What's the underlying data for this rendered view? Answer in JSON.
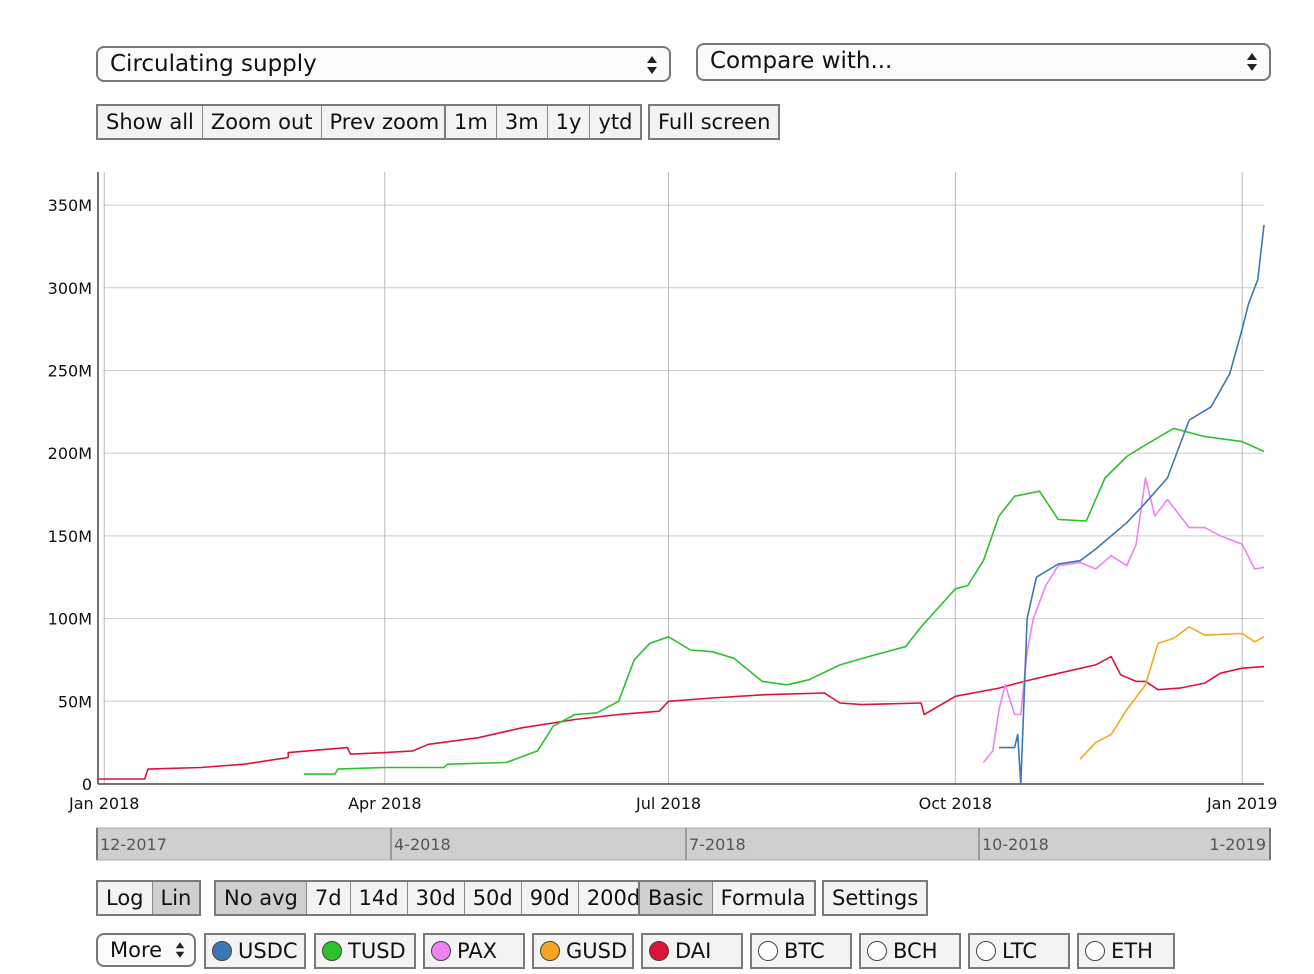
{
  "controls": {
    "metric_select": "Circulating supply",
    "compare_select": "Compare with...",
    "zoom_buttons": [
      "Show all",
      "Zoom out",
      "Prev zoom"
    ],
    "range_buttons": [
      "1m",
      "3m",
      "1y",
      "ytd"
    ],
    "fullscreen_label": "Full screen",
    "scale_buttons": [
      "Log",
      "Lin"
    ],
    "scale_active": "Lin",
    "avg_buttons": [
      "No avg",
      "7d",
      "14d",
      "30d",
      "50d",
      "90d",
      "200d"
    ],
    "avg_active": "No avg",
    "mode_buttons": [
      "Basic",
      "Formula"
    ],
    "mode_active": "Basic",
    "settings_label": "Settings",
    "more_label": "More"
  },
  "legend": [
    {
      "label": "USDC",
      "color": "#3c78b4",
      "active": true
    },
    {
      "label": "TUSD",
      "color": "#2fc02f",
      "active": true
    },
    {
      "label": "PAX",
      "color": "#ee82ee",
      "active": true
    },
    {
      "label": "GUSD",
      "color": "#f5a623",
      "active": true
    },
    {
      "label": "DAI",
      "color": "#dc143c",
      "active": true
    },
    {
      "label": "BTC",
      "color": "#ffffff",
      "active": false
    },
    {
      "label": "BCH",
      "color": "#ffffff",
      "active": false
    },
    {
      "label": "LTC",
      "color": "#ffffff",
      "active": false
    },
    {
      "label": "ETH",
      "color": "#ffffff",
      "active": false
    }
  ],
  "navigator": {
    "labels": [
      "12-2017",
      "4-2018",
      "7-2018",
      "10-2018",
      "1-2019"
    ]
  },
  "chart_data": {
    "type": "line",
    "title": "",
    "xlabel": "",
    "ylabel": "",
    "x_ticks": [
      "Jan 2018",
      "Apr 2018",
      "Jul 2018",
      "Oct 2018",
      "Jan 2019"
    ],
    "x_tick_dates": [
      "2018-01-01",
      "2018-04-01",
      "2018-07-01",
      "2018-10-01",
      "2019-01-01"
    ],
    "y_ticks": [
      "0",
      "50M",
      "100M",
      "150M",
      "200M",
      "250M",
      "300M",
      "350M"
    ],
    "y_tick_values": [
      0,
      50,
      100,
      150,
      200,
      250,
      300,
      350
    ],
    "y_unit": "M",
    "xlim": [
      "2017-12-30",
      "2019-01-08"
    ],
    "ylim": [
      0,
      370
    ],
    "grid": true,
    "series": [
      {
        "name": "DAI",
        "color": "#dc143c",
        "points": [
          [
            "2017-12-30",
            3
          ],
          [
            "2018-01-14",
            3
          ],
          [
            "2018-01-15",
            9
          ],
          [
            "2018-02-01",
            10
          ],
          [
            "2018-02-15",
            12
          ],
          [
            "2018-03-01",
            16
          ],
          [
            "2018-03-01",
            19
          ],
          [
            "2018-03-20",
            22
          ],
          [
            "2018-03-21",
            18
          ],
          [
            "2018-04-01",
            19
          ],
          [
            "2018-04-10",
            20
          ],
          [
            "2018-04-15",
            24
          ],
          [
            "2018-05-01",
            28
          ],
          [
            "2018-05-15",
            34
          ],
          [
            "2018-06-01",
            39
          ],
          [
            "2018-06-15",
            42
          ],
          [
            "2018-06-28",
            44
          ],
          [
            "2018-07-01",
            50
          ],
          [
            "2018-07-15",
            52
          ],
          [
            "2018-08-01",
            54
          ],
          [
            "2018-08-20",
            55
          ],
          [
            "2018-08-25",
            49
          ],
          [
            "2018-09-01",
            48
          ],
          [
            "2018-09-20",
            49
          ],
          [
            "2018-09-21",
            42
          ],
          [
            "2018-10-01",
            53
          ],
          [
            "2018-10-15",
            58
          ],
          [
            "2018-10-23",
            62
          ],
          [
            "2018-11-01",
            66
          ],
          [
            "2018-11-15",
            72
          ],
          [
            "2018-11-20",
            77
          ],
          [
            "2018-11-23",
            66
          ],
          [
            "2018-11-28",
            62
          ],
          [
            "2018-12-01",
            62
          ],
          [
            "2018-12-05",
            57
          ],
          [
            "2018-12-12",
            58
          ],
          [
            "2018-12-20",
            61
          ],
          [
            "2018-12-25",
            67
          ],
          [
            "2019-01-01",
            70
          ],
          [
            "2019-01-08",
            71
          ]
        ]
      },
      {
        "name": "TUSD",
        "color": "#2fc02f",
        "points": [
          [
            "2018-03-06",
            6
          ],
          [
            "2018-03-16",
            6
          ],
          [
            "2018-03-17",
            9
          ],
          [
            "2018-04-01",
            10
          ],
          [
            "2018-04-20",
            10
          ],
          [
            "2018-04-21",
            12
          ],
          [
            "2018-05-10",
            13
          ],
          [
            "2018-05-20",
            20
          ],
          [
            "2018-05-25",
            35
          ],
          [
            "2018-06-01",
            42
          ],
          [
            "2018-06-08",
            43
          ],
          [
            "2018-06-15",
            50
          ],
          [
            "2018-06-20",
            75
          ],
          [
            "2018-06-25",
            85
          ],
          [
            "2018-07-01",
            89
          ],
          [
            "2018-07-08",
            81
          ],
          [
            "2018-07-15",
            80
          ],
          [
            "2018-07-22",
            76
          ],
          [
            "2018-07-31",
            62
          ],
          [
            "2018-08-08",
            60
          ],
          [
            "2018-08-15",
            63
          ],
          [
            "2018-08-25",
            72
          ],
          [
            "2018-09-05",
            78
          ],
          [
            "2018-09-15",
            83
          ],
          [
            "2018-09-20",
            95
          ],
          [
            "2018-10-01",
            118
          ],
          [
            "2018-10-05",
            120
          ],
          [
            "2018-10-10",
            135
          ],
          [
            "2018-10-15",
            162
          ],
          [
            "2018-10-20",
            174
          ],
          [
            "2018-10-28",
            177
          ],
          [
            "2018-11-03",
            160
          ],
          [
            "2018-11-12",
            159
          ],
          [
            "2018-11-18",
            185
          ],
          [
            "2018-11-25",
            198
          ],
          [
            "2018-12-01",
            205
          ],
          [
            "2018-12-10",
            215
          ],
          [
            "2018-12-20",
            210
          ],
          [
            "2019-01-01",
            207
          ],
          [
            "2019-01-08",
            201
          ]
        ]
      },
      {
        "name": "PAX",
        "color": "#ee82ee",
        "points": [
          [
            "2018-10-10",
            13
          ],
          [
            "2018-10-13",
            20
          ],
          [
            "2018-10-15",
            45
          ],
          [
            "2018-10-17",
            60
          ],
          [
            "2018-10-20",
            42
          ],
          [
            "2018-10-22",
            42
          ],
          [
            "2018-10-24",
            80
          ],
          [
            "2018-10-26",
            100
          ],
          [
            "2018-10-30",
            120
          ],
          [
            "2018-11-03",
            132
          ],
          [
            "2018-11-10",
            134
          ],
          [
            "2018-11-15",
            130
          ],
          [
            "2018-11-20",
            138
          ],
          [
            "2018-11-25",
            132
          ],
          [
            "2018-11-28",
            145
          ],
          [
            "2018-12-01",
            185
          ],
          [
            "2018-12-04",
            162
          ],
          [
            "2018-12-08",
            172
          ],
          [
            "2018-12-15",
            155
          ],
          [
            "2018-12-20",
            155
          ],
          [
            "2018-12-25",
            150
          ],
          [
            "2019-01-01",
            145
          ],
          [
            "2019-01-05",
            130
          ],
          [
            "2019-01-08",
            131
          ]
        ]
      },
      {
        "name": "USDC",
        "color": "#3c78b4",
        "points": [
          [
            "2018-10-15",
            22
          ],
          [
            "2018-10-20",
            22
          ],
          [
            "2018-10-21",
            30
          ],
          [
            "2018-10-22",
            0
          ],
          [
            "2018-10-24",
            100
          ],
          [
            "2018-10-27",
            125
          ],
          [
            "2018-11-03",
            133
          ],
          [
            "2018-11-10",
            135
          ],
          [
            "2018-11-15",
            142
          ],
          [
            "2018-11-20",
            150
          ],
          [
            "2018-11-25",
            158
          ],
          [
            "2018-12-01",
            170
          ],
          [
            "2018-12-08",
            185
          ],
          [
            "2018-12-15",
            220
          ],
          [
            "2018-12-22",
            228
          ],
          [
            "2018-12-28",
            248
          ],
          [
            "2019-01-01",
            275
          ],
          [
            "2019-01-03",
            290
          ],
          [
            "2019-01-06",
            305
          ],
          [
            "2019-01-08",
            338
          ]
        ]
      },
      {
        "name": "GUSD",
        "color": "#f5a623",
        "points": [
          [
            "2018-11-10",
            15
          ],
          [
            "2018-11-15",
            25
          ],
          [
            "2018-11-20",
            30
          ],
          [
            "2018-11-25",
            45
          ],
          [
            "2018-12-01",
            60
          ],
          [
            "2018-12-05",
            85
          ],
          [
            "2018-12-10",
            88
          ],
          [
            "2018-12-15",
            95
          ],
          [
            "2018-12-20",
            90
          ],
          [
            "2019-01-01",
            91
          ],
          [
            "2019-01-05",
            86
          ],
          [
            "2019-01-08",
            89
          ]
        ]
      }
    ]
  }
}
